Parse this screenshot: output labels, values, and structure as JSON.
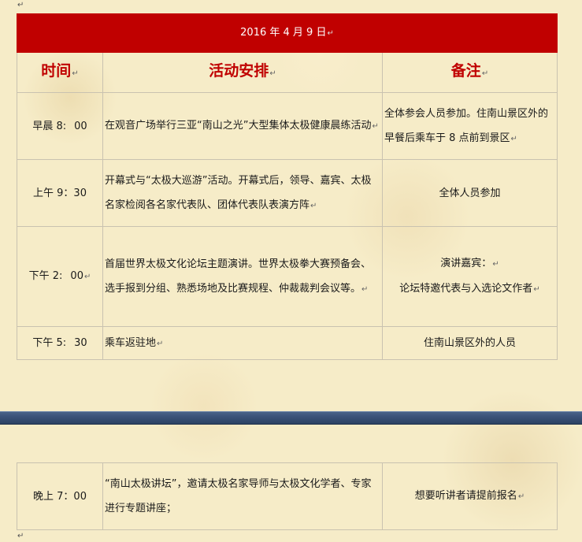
{
  "paragraph_mark": "↵",
  "cell_mark": "↵",
  "header": {
    "date": "2016 年 4 月 9 日",
    "col_time": "时间",
    "col_activity": "活动安排",
    "col_note": "备注"
  },
  "rows": [
    {
      "time": "早晨 8:",
      "time_min": "00",
      "activity": "在观音广场举行三亚“南山之光”大型集体太极健康晨练活动",
      "note": "全体参会人员参加。住南山景区外的早餐后乘车于 8 点前到景区"
    },
    {
      "time": "上午 9：30",
      "time_min": "",
      "activity": "开幕式与“太极大巡游”活动。开幕式后，领导、嘉宾、太极名家检阅各名家代表队、团体代表队表演方阵",
      "note": "全体人员参加"
    },
    {
      "time": "下午 2:",
      "time_min": "00",
      "activity": "首届世界太极文化论坛主题演讲。世界太极拳大赛预备会、选手报到分组、熟悉场地及比赛规程、仲裁裁判会议等。",
      "note_line1": "演讲嘉宾：",
      "note_line2": "论坛特邀代表与入选论文作者"
    },
    {
      "time": "下午 5:",
      "time_min": "30",
      "activity": "乘车返驻地",
      "note": "住南山景区外的人员"
    }
  ],
  "evening": {
    "time": "晚上 7：00",
    "activity": "“南山太极讲坛”，邀请太极名家导师与太极文化学者、专家进行专题讲座；",
    "note": "想要听讲者请提前报名"
  },
  "colors": {
    "header_red": "#c00000",
    "divider_blue": "#3a5278",
    "background": "#f6ecc8"
  }
}
